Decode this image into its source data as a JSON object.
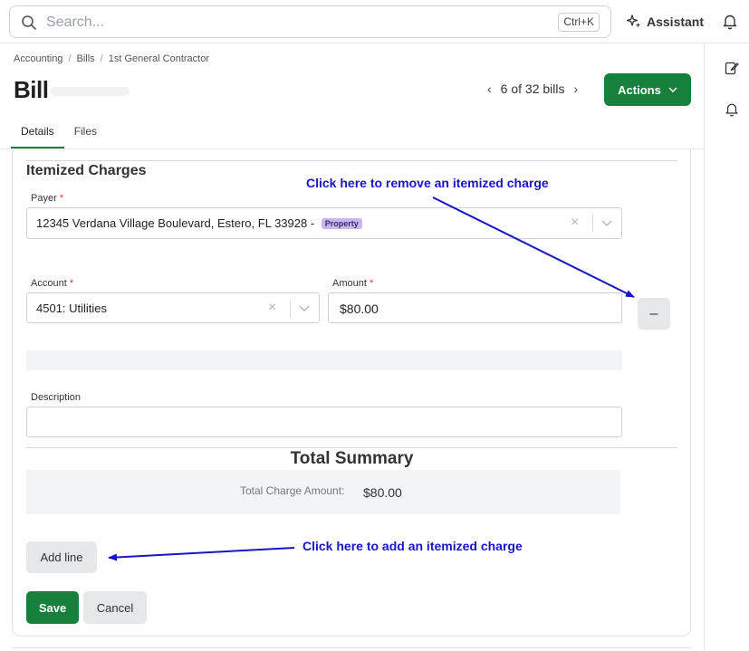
{
  "search": {
    "placeholder": "Search...",
    "shortcut": "Ctrl+K"
  },
  "topbar": {
    "assistant_label": "Assistant"
  },
  "breadcrumb": [
    "Accounting",
    "Bills",
    "1st General Contractor"
  ],
  "page": {
    "title": "Bill"
  },
  "pager": {
    "text": "6 of 32 bills"
  },
  "actions": {
    "label": "Actions"
  },
  "tabs": [
    {
      "label": "Details",
      "active": true
    },
    {
      "label": "Files",
      "active": false
    }
  ],
  "itemized": {
    "title": "Itemized Charges",
    "payer": {
      "label": "Payer",
      "required": "*",
      "value": "12345 Verdana Village Boulevard, Estero, FL 33928 -",
      "badge": "Property"
    },
    "account": {
      "label": "Account",
      "required": "*",
      "value": "4501: Utilities"
    },
    "amount": {
      "label": "Amount",
      "required": "*",
      "value": "$80.00"
    },
    "remove_label": "–",
    "description": {
      "label": "Description",
      "value": ""
    }
  },
  "summary": {
    "title": "Total Summary",
    "label": "Total Charge Amount:",
    "value": "$80.00"
  },
  "buttons": {
    "add_line": "Add line",
    "save": "Save",
    "cancel": "Cancel"
  },
  "annotations": {
    "remove": "Click here to remove an itemized charge",
    "add": "Click here to add an itemized charge",
    "color": "#1616c8"
  },
  "colors": {
    "primary": "#16803c",
    "badge": "#c9b6ef",
    "required": "#d0342c"
  }
}
